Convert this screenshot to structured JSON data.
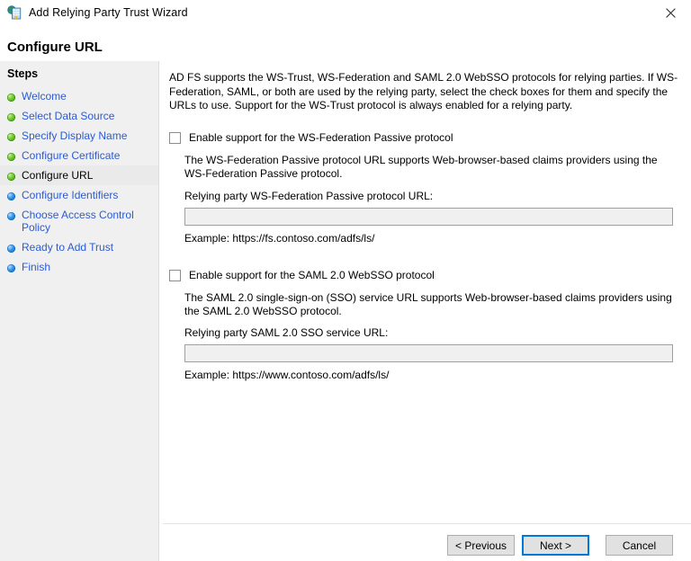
{
  "window": {
    "title": "Add Relying Party Trust Wizard",
    "icon": "adfs-wizard-icon",
    "close_label": "✕"
  },
  "page": {
    "title": "Configure URL"
  },
  "sidebar": {
    "heading": "Steps",
    "items": [
      {
        "label": "Welcome",
        "state": "done",
        "bullet": "green",
        "current": false
      },
      {
        "label": "Select Data Source",
        "state": "done",
        "bullet": "green",
        "current": false
      },
      {
        "label": "Specify Display Name",
        "state": "done",
        "bullet": "green",
        "current": false
      },
      {
        "label": "Configure Certificate",
        "state": "done",
        "bullet": "green",
        "current": false
      },
      {
        "label": "Configure URL",
        "state": "current",
        "bullet": "green",
        "current": true
      },
      {
        "label": "Configure Identifiers",
        "state": "pending",
        "bullet": "blue",
        "current": false
      },
      {
        "label": "Choose Access Control Policy",
        "state": "pending",
        "bullet": "blue",
        "current": false
      },
      {
        "label": "Ready to Add Trust",
        "state": "pending",
        "bullet": "blue",
        "current": false
      },
      {
        "label": "Finish",
        "state": "pending",
        "bullet": "blue",
        "current": false
      }
    ]
  },
  "main": {
    "intro": "AD FS supports the WS-Trust, WS-Federation and SAML 2.0 WebSSO protocols for relying parties.  If WS-Federation, SAML, or both are used by the relying party, select the check boxes for them and specify the URLs to use.  Support for the WS-Trust protocol is always enabled for a relying party.",
    "wsfed": {
      "checkbox_label": "Enable support for the WS-Federation Passive protocol",
      "checked": false,
      "description": "The WS-Federation Passive protocol URL supports Web-browser-based claims providers using the WS-Federation Passive protocol.",
      "field_label": "Relying party WS-Federation Passive protocol URL:",
      "field_value": "",
      "field_placeholder": "",
      "field_enabled": false,
      "example": "Example: https://fs.contoso.com/adfs/ls/"
    },
    "saml": {
      "checkbox_label": "Enable support for the SAML 2.0 WebSSO protocol",
      "checked": false,
      "description": "The SAML 2.0 single-sign-on (SSO) service URL supports Web-browser-based claims providers using the SAML 2.0 WebSSO protocol.",
      "field_label": "Relying party SAML 2.0 SSO service URL:",
      "field_value": "",
      "field_placeholder": "",
      "field_enabled": false,
      "example": "Example: https://www.contoso.com/adfs/ls/"
    }
  },
  "buttons": {
    "previous": "< Previous",
    "next": "Next >",
    "cancel": "Cancel",
    "default_button": "next"
  },
  "colors": {
    "link": "#2a5bd7",
    "bullet_done": "#5aba22",
    "bullet_pending": "#2f92e8",
    "default_button_focus": "#0078d7",
    "sidebar_bg": "#f0f0f0",
    "current_step_bg": "#eaeaea",
    "disabled_field_bg": "#f0f0f0"
  }
}
